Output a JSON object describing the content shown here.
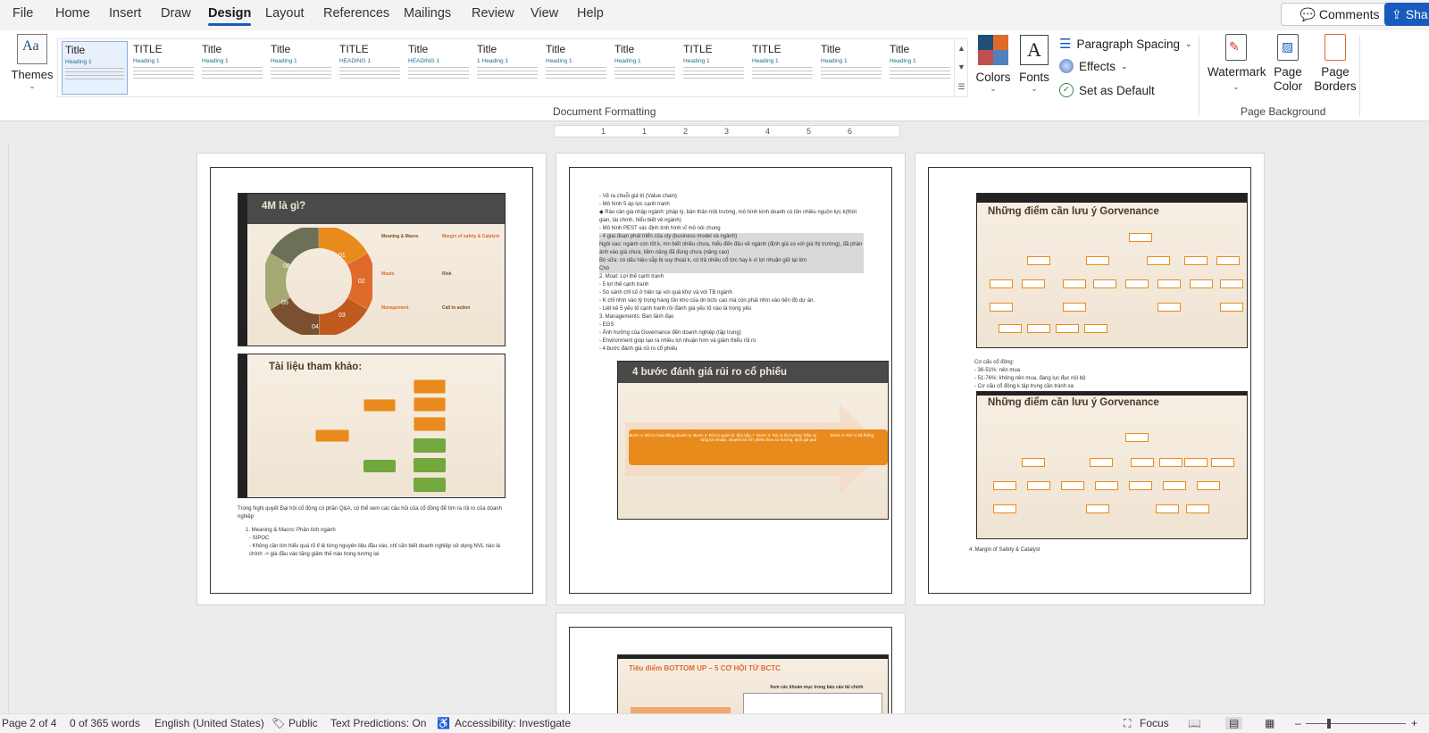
{
  "menu": {
    "items": [
      "File",
      "Home",
      "Insert",
      "Draw",
      "Design",
      "Layout",
      "References",
      "Mailings",
      "Review",
      "View",
      "Help"
    ],
    "active": "Design",
    "comments": "Comments",
    "share": "Sha"
  },
  "ribbon": {
    "themes": "Themes",
    "style_gallery": [
      {
        "title": "Title",
        "heading": "Heading 1"
      },
      {
        "title": "TITLE",
        "heading": "Heading 1"
      },
      {
        "title": "Title",
        "heading": "Heading 1"
      },
      {
        "title": "Title",
        "heading": "Heading 1"
      },
      {
        "title": "TITLE",
        "heading": "HEADING 1"
      },
      {
        "title": "Title",
        "heading": "HEADING 1"
      },
      {
        "title": "Title",
        "heading": "1 Heading 1"
      },
      {
        "title": "Title",
        "heading": "Heading 1"
      },
      {
        "title": "Title",
        "heading": "Heading 1"
      },
      {
        "title": "TITLE",
        "heading": "Heading 1"
      },
      {
        "title": "TITLE",
        "heading": "Heading 1"
      },
      {
        "title": "Title",
        "heading": "Heading 1"
      },
      {
        "title": "Title",
        "heading": "Heading 1"
      }
    ],
    "colors": "Colors",
    "fonts": "Fonts",
    "paragraph_spacing": "Paragraph Spacing",
    "effects": "Effects",
    "set_default": "Set as Default",
    "doc_formatting_label": "Document Formatting",
    "watermark": "Watermark",
    "page_color_1": "Page",
    "page_color_2": "Color",
    "page_borders_1": "Page",
    "page_borders_2": "Borders",
    "page_background_label": "Page Background",
    "accent": "#185abd"
  },
  "ruler_numbers": [
    "1",
    "1",
    "2",
    "3",
    "4",
    "5",
    "6"
  ],
  "page1": {
    "slide1_title": "4M là gì?",
    "slide1_segments": [
      "01",
      "02",
      "03",
      "04",
      "05",
      "06"
    ],
    "slide1_labels": [
      "Meaning & Macro",
      "Margin of safety & Catalyst",
      "Moats",
      "Risk",
      "Management",
      "Call to action"
    ],
    "slide2_title": "Tài liệu tham khảo:",
    "text_intro": "Trong Nghị quyết Đại hội cổ đông có phần Q&A, có thể xem các câu hỏi của cổ đông để tìm ra rủi ro của doanh nghiệp",
    "list": [
      "1.  Meaning & Macro: Phân tích ngành",
      "-   SIPOC",
      "-   Không cần tìm hiểu quá rõ tỉ lệ từng nguyên liệu đầu vào, chỉ cần biết doanh nghiệp sử dụng NVL nào là chính -> giá đầu vào tăng giảm thế nào trong tương lai"
    ]
  },
  "page2": {
    "lines": [
      "-   Vẽ ra chuỗi giá trị (Value chain)",
      "-   Mô hình 5 áp lực cạnh tranh",
      "      ◆  Rào cản gia nhập ngành: pháp lý, bản thân môi trường, mô hình kinh doanh có tồn nhiều nguồn lực k(thời gian, tài chính, hiểu biết về ngành)",
      "-   Mô hình PEST xác định tình hình vĩ mô nói chung",
      "-   4 giai đoạn phát triển của cty (business model và ngành)",
      "    Ngôi sao: ngành còn tốt k, mn biết nhiều chưa, hiểu đến đâu về ngành (định giá so với giá thị trường), đã phản ánh vào giá chưa, tiềm năng đã đúng chưa (nâng cao)",
      "    Bò sữa: có dấu hiệu sắp bị suy thoái k, có trả nhiều cổ tức hay k vì lợi nhuận giữ lại lớn",
      "    Chó",
      "2.  Moat: Lợi thế cạnh tranh",
      "-   5 lợi thế cạnh tranh",
      "-   So sánh chỉ số ở hiện tại với quá khứ và với TB ngành",
      "-   K chỉ nhìn vào tỷ trọng hàng tồn kho của dn bcts cao mà còn phải nhìn vào tiến độ dự án.",
      "-   Liệt kê 5 yếu tố cạnh tranh rồi đánh giá yếu tố nào là trọng yếu",
      "3.  Managements: Ban lãnh đạo",
      "-   EGS",
      "-   Ảnh hưởng của Governance đến doanh nghiệp (tập trung)",
      "-   Environment giúp tạo ra nhiều lợi nhuận hơn và giảm thiểu rủi ro",
      "-   4 bước đánh giá rủi ro cổ phiếu"
    ],
    "slide_title": "4 bước đánh giá rủi ro cổ phiếu",
    "steps": [
      "Bước 1: Rủi ro hoạt động doanh nghiệp",
      "Bước 2: Rủi ro quản trị: đòn bẩy, thao túng lợi nhuận, chuyển lợi ích",
      "Bước 3: Rủi ro thị trường: Đầu cơ cổ phiếu theo xu hướng, định giá quá cao",
      "Bước 4: Rủi ro hệ thống"
    ]
  },
  "page3": {
    "slide1_title": "Những điểm cần lưu ý Gorvenance",
    "text": [
      "Cơ cấu cổ đông:",
      "-   36-51%: nên mua",
      "-   51-76%: không nên mua, đang lục đục nội bộ",
      "-   Cơ cấu cổ đông k tập trung cần tránh xa"
    ],
    "slide2_title": "Những điểm cần lưu ý Gorvenance",
    "list_item": "4.   Margin of Safety & Catalyst"
  },
  "page4": {
    "slide_title": "Tiêu điểm BOTTOM UP – 5 CƠ HỘI TỪ BCTC",
    "slide_subtitle": "Xem các khoản mục trong báo cáo tài chính"
  },
  "status": {
    "page": "Page 2 of 4",
    "words": "0 of 365 words",
    "language": "English (United States)",
    "sensitivity": "Public",
    "predictions": "Text Predictions: On",
    "accessibility": "Accessibility: Investigate",
    "focus": "Focus",
    "zoom_minus": "–",
    "zoom_plus": "+"
  }
}
